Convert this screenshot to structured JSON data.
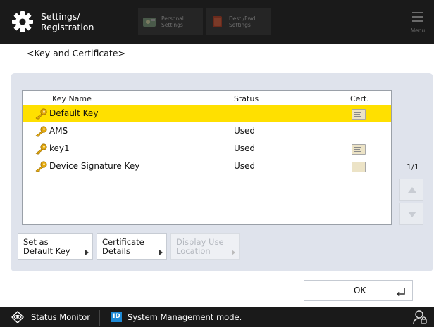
{
  "header": {
    "title_line1": "Settings/",
    "title_line2": "Registration",
    "tabs": [
      {
        "line1": "Personal",
        "line2": "Settings",
        "icon": "personal-settings-icon"
      },
      {
        "line1": "Dest./Fwd.",
        "line2": "Settings",
        "icon": "destination-book-icon"
      }
    ],
    "menu_label": "Menu"
  },
  "page_title": "<Key and Certificate>",
  "table": {
    "columns": [
      "Key Name",
      "Status",
      "Cert."
    ],
    "rows": [
      {
        "name": "Default Key",
        "status": "",
        "cert": true,
        "selected": true
      },
      {
        "name": "AMS",
        "status": "Used",
        "cert": false,
        "selected": false
      },
      {
        "name": "key1",
        "status": "Used",
        "cert": true,
        "selected": false
      },
      {
        "name": "Device Signature Key",
        "status": "Used",
        "cert": true,
        "selected": false
      }
    ]
  },
  "pagination": "1/1",
  "actions": {
    "set_default_line1": "Set as",
    "set_default_line2": "Default Key",
    "cert_details_line1": "Certificate",
    "cert_details_line2": "Details",
    "display_use_line1": "Display Use",
    "display_use_line2": "Location"
  },
  "ok_label": "OK",
  "footer": {
    "status_monitor": "Status Monitor",
    "id_badge": "ID",
    "mode_text": "System Management mode."
  },
  "colors": {
    "topbar": "#1a1a1a",
    "selected_row": "#ffe000",
    "panel": "#dfe3ec",
    "id_badge": "#1e8ad6"
  }
}
